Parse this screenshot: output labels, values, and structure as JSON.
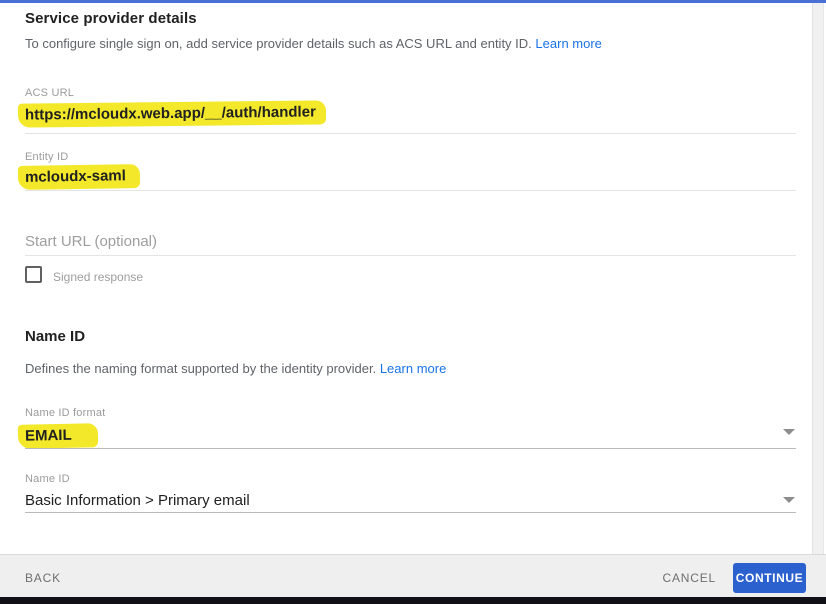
{
  "dialog": {
    "title": "Service provider details",
    "description": "To configure single sign on, add service provider details such as ACS URL and entity ID.",
    "learn_more": "Learn more"
  },
  "fields": {
    "acs_url": {
      "label": "ACS URL",
      "value": "https://mcloudx.web.app/__/auth/handler",
      "highlighted": true
    },
    "entity_id": {
      "label": "Entity ID",
      "value": "mcloudx-saml",
      "highlighted": true
    },
    "start_url": {
      "placeholder": "Start URL (optional)",
      "value": ""
    },
    "signed_response": {
      "label": "Signed response",
      "checked": false
    }
  },
  "name_id_section": {
    "title": "Name ID",
    "description": "Defines the naming format supported by the identity provider.",
    "learn_more": "Learn more",
    "name_id_format": {
      "label": "Name ID format",
      "value": "EMAIL",
      "highlighted": true
    },
    "name_id": {
      "label": "Name ID",
      "value": "Basic Information > Primary email",
      "highlighted": false
    }
  },
  "footer": {
    "back_label": "BACK",
    "cancel_label": "CANCEL",
    "continue_label": "CONTINUE"
  },
  "colors": {
    "top_bar_blue": "#4a6fd5",
    "continue_blue": "#2b60cf",
    "link_blue": "#1a73e8",
    "highlight_yellow": "#f3e829",
    "bottom_bar_black": "#101016"
  }
}
